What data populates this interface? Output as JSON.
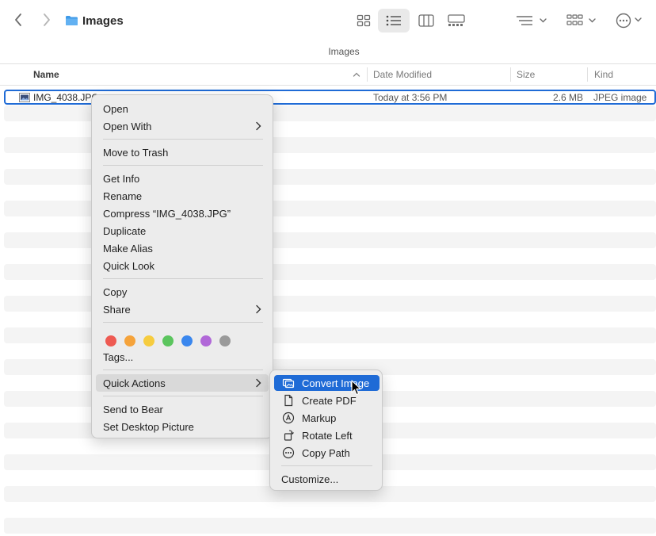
{
  "window": {
    "title": "Images",
    "path_label": "Images"
  },
  "columns": {
    "name": "Name",
    "date": "Date Modified",
    "size": "Size",
    "kind": "Kind"
  },
  "file": {
    "name": "IMG_4038.JPG",
    "date": "Today at 3:56 PM",
    "size": "2.6 MB",
    "kind": "JPEG image"
  },
  "context_menu": {
    "open": "Open",
    "open_with": "Open With",
    "move_to_trash": "Move to Trash",
    "get_info": "Get Info",
    "rename": "Rename",
    "compress": "Compress “IMG_4038.JPG”",
    "duplicate": "Duplicate",
    "make_alias": "Make Alias",
    "quick_look": "Quick Look",
    "copy": "Copy",
    "share": "Share",
    "tags": "Tags...",
    "quick_actions": "Quick Actions",
    "send_to_bear": "Send to Bear",
    "set_desktop_picture": "Set Desktop Picture"
  },
  "tag_colors": [
    "#ee5a52",
    "#f5a33b",
    "#f6cc3f",
    "#5bc55e",
    "#3a87ee",
    "#b168d8",
    "#9a9a9a"
  ],
  "quick_actions_menu": {
    "convert_image": "Convert Image",
    "create_pdf": "Create PDF",
    "markup": "Markup",
    "rotate_left": "Rotate Left",
    "copy_path": "Copy Path",
    "customize": "Customize..."
  },
  "colors": {
    "accent": "#1f6bd6",
    "folder": "#3f9ae8"
  }
}
